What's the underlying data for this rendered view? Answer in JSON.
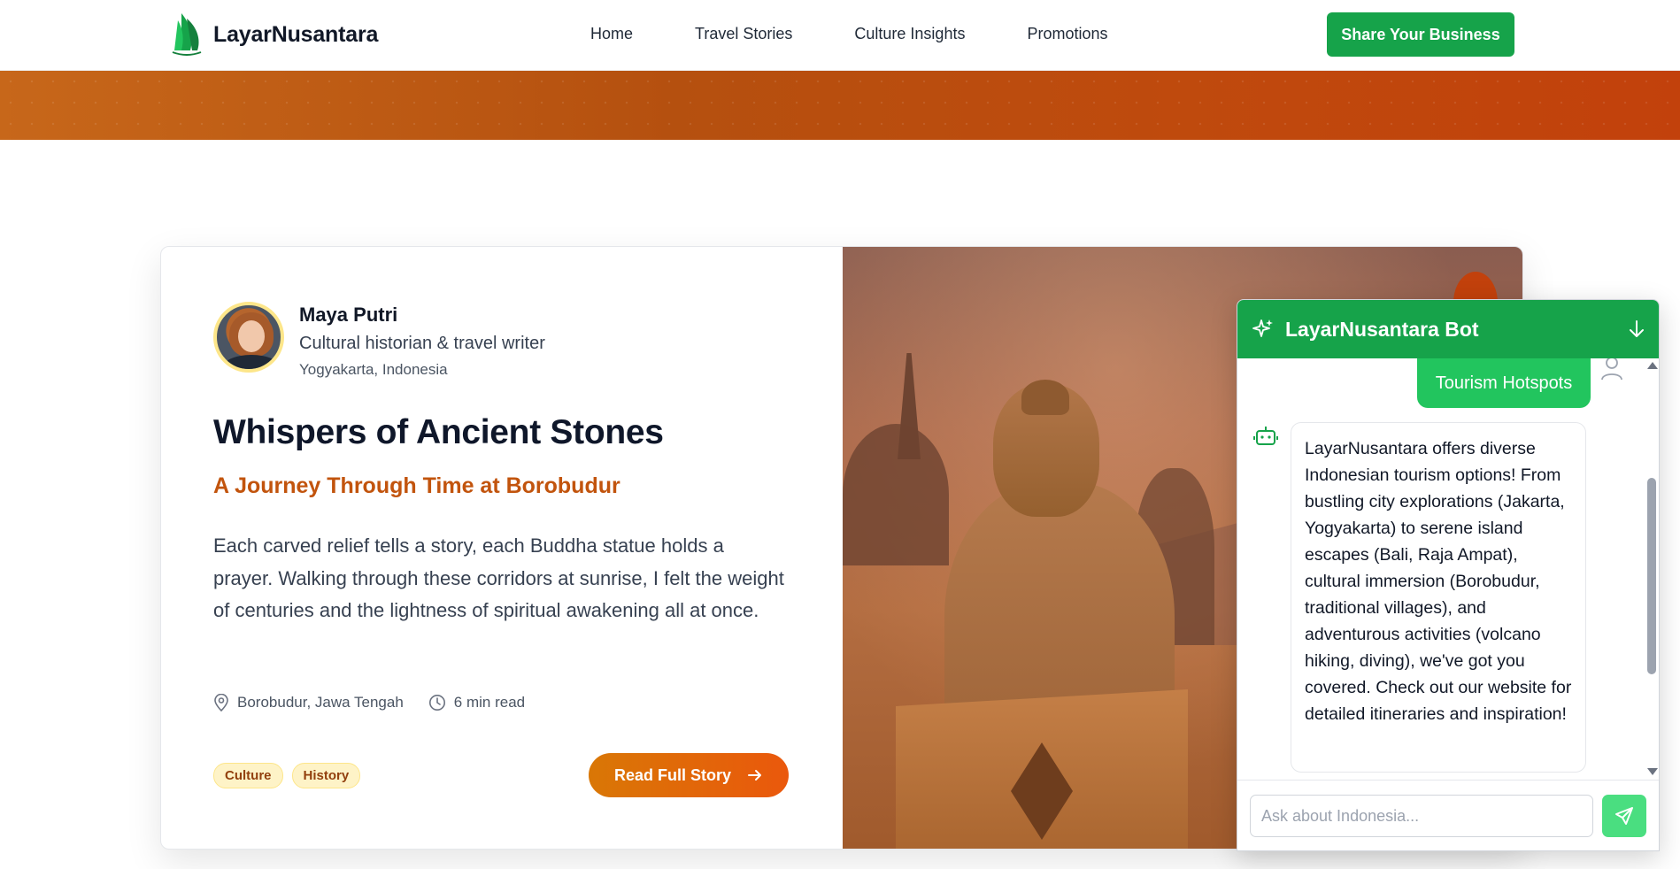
{
  "header": {
    "brand": "LayarNusantara",
    "nav": [
      "Home",
      "Travel Stories",
      "Culture Insights",
      "Promotions"
    ],
    "cta_label": "Share Your Business"
  },
  "story": {
    "author_name": "Maya Putri",
    "author_role": "Cultural historian & travel writer",
    "author_location": "Yogyakarta, Indonesia",
    "title": "Whispers of Ancient Stones",
    "subtitle": "A Journey Through Time at Borobudur",
    "excerpt": "Each carved relief tells a story, each Buddha statue holds a prayer. Walking through these corridors at sunrise, I felt the weight of centuries and the lightness of spiritual awakening all at once.",
    "location": "Borobudur, Jawa Tengah",
    "read_time": "6 min read",
    "tags": [
      "Culture",
      "History"
    ],
    "read_button": "Read Full Story"
  },
  "chat": {
    "title": "LayarNusantara Bot",
    "user_message": "Tourism Hotspots",
    "bot_message": "LayarNusantara offers diverse Indonesian tourism options! From bustling city explorations (Jakarta, Yogyakarta) to serene island escapes (Bali, Raja Ampat), cultural immersion (Borobudur, traditional villages), and adventurous activities (volcano hiking, diving), we've got you covered. Check out our website for detailed itineraries and inspiration!",
    "input_placeholder": "Ask about Indonesia..."
  },
  "colors": {
    "brand_green": "#16a34a",
    "accent_orange": "#ea580c",
    "banner": "#c2410c"
  },
  "icons": {
    "logo": "sail-logo-icon",
    "location": "map-pin-icon",
    "time": "clock-icon",
    "read_arrow": "arrow-right-icon",
    "chat_sparkle": "sparkle-icon",
    "chat_collapse": "arrow-down-icon",
    "user": "user-icon",
    "bot": "bot-icon",
    "send": "send-icon"
  }
}
